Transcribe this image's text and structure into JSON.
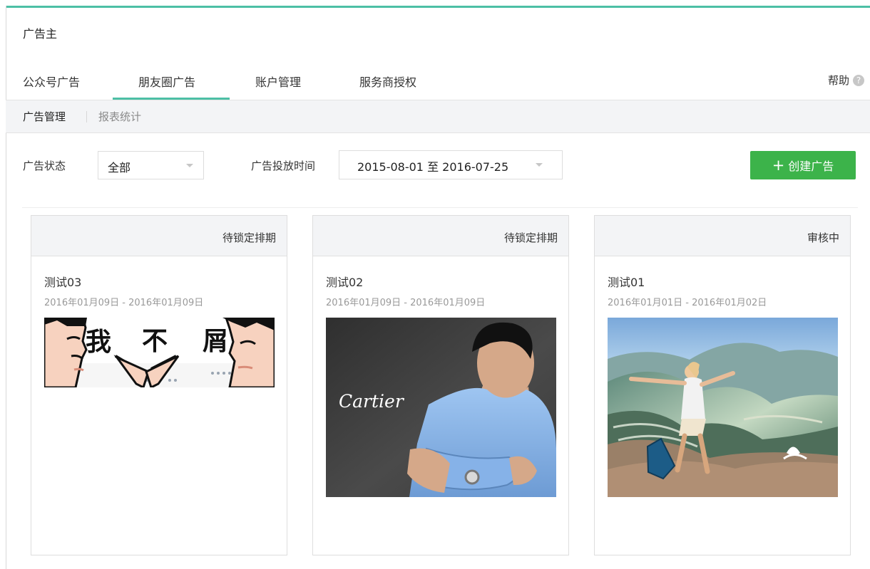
{
  "app": {
    "title": "广告主"
  },
  "tabs": [
    {
      "label": "公众号广告"
    },
    {
      "label": "朋友圈广告",
      "active": true
    },
    {
      "label": "账户管理"
    },
    {
      "label": "服务商授权"
    }
  ],
  "help": {
    "label": "帮助",
    "icon": "question-circle-icon"
  },
  "subnav": [
    {
      "label": "广告管理",
      "active": true
    },
    {
      "label": "报表统计",
      "active": false
    }
  ],
  "filters": {
    "status_label": "广告状态",
    "status_value": "全部",
    "time_label": "广告投放时间",
    "date_range": "2015-08-01 至 2016-07-25"
  },
  "create_button": {
    "label": "+ 创建广告",
    "plus": "+",
    "text": "创建广告"
  },
  "cards": [
    {
      "status": "待锁定排期",
      "title": "测试03",
      "date": "2016年01月09日 - 2016年01月09日",
      "image_text": [
        "我",
        "不",
        "屑"
      ]
    },
    {
      "status": "待锁定排期",
      "title": "测试02",
      "date": "2016年01月09日 - 2016年01月09日",
      "image_text": "Cartier"
    },
    {
      "status": "审核中",
      "title": "测试01",
      "date": "2016年01月01日 - 2016年01月02日"
    }
  ],
  "colors": {
    "accent": "#4cbfa5",
    "button": "#3cb34a",
    "panel": "#f3f4f6"
  }
}
